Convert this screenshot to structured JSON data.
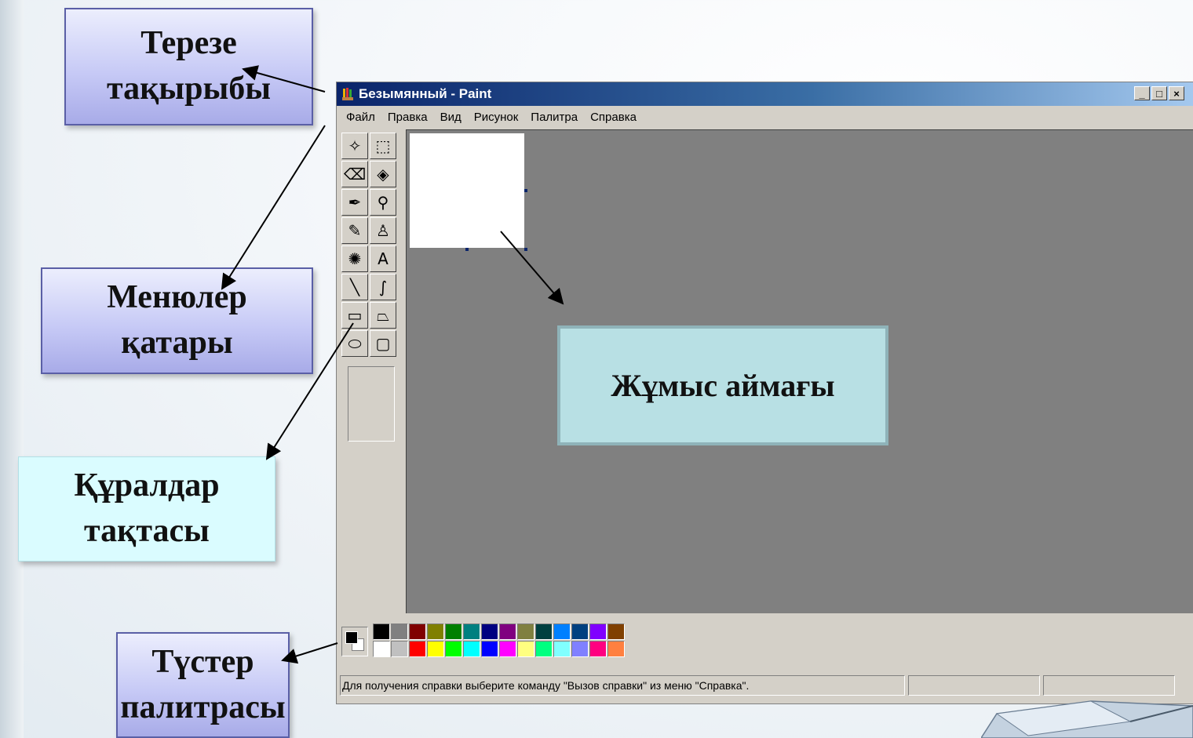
{
  "callouts": {
    "window_title": [
      "Терезе",
      "тақырыбы"
    ],
    "menu_bar": [
      "Менюлер",
      "қатары"
    ],
    "toolbox": [
      "Құралдар",
      "тақтасы"
    ],
    "palette": [
      "Түстер",
      "палитрасы"
    ],
    "work_area": "Жұмыс аймағы"
  },
  "paint": {
    "title": "Безымянный - Paint",
    "window_buttons": {
      "minimize": "_",
      "maximize": "□",
      "close": "×"
    },
    "menu": [
      "Файл",
      "Правка",
      "Вид",
      "Рисунок",
      "Палитра",
      "Справка"
    ],
    "tools": [
      {
        "name": "free-select",
        "icon": "✧"
      },
      {
        "name": "select",
        "icon": "⬚"
      },
      {
        "name": "eraser",
        "icon": "⌫"
      },
      {
        "name": "fill",
        "icon": "◈"
      },
      {
        "name": "color-picker",
        "icon": "✒"
      },
      {
        "name": "magnifier",
        "icon": "⚲"
      },
      {
        "name": "pencil",
        "icon": "✎"
      },
      {
        "name": "brush",
        "icon": "♙"
      },
      {
        "name": "airbrush",
        "icon": "✺"
      },
      {
        "name": "text",
        "icon": "A"
      },
      {
        "name": "line",
        "icon": "╲"
      },
      {
        "name": "curve",
        "icon": "∫"
      },
      {
        "name": "rectangle",
        "icon": "▭"
      },
      {
        "name": "polygon",
        "icon": "⏢"
      },
      {
        "name": "ellipse",
        "icon": "⬭"
      },
      {
        "name": "rounded-rectangle",
        "icon": "▢"
      }
    ],
    "palette_top": [
      "#000000",
      "#808080",
      "#800000",
      "#808000",
      "#008000",
      "#008080",
      "#000080",
      "#800080",
      "#808040",
      "#004040",
      "#0080ff",
      "#004080",
      "#8000ff",
      "#804000"
    ],
    "palette_bottom": [
      "#ffffff",
      "#c0c0c0",
      "#ff0000",
      "#ffff00",
      "#00ff00",
      "#00ffff",
      "#0000ff",
      "#ff00ff",
      "#ffff80",
      "#00ff80",
      "#80ffff",
      "#8080ff",
      "#ff0080",
      "#ff8040"
    ],
    "status_text": "Для получения справки выберите команду \"Вызов справки\" из меню \"Справка\"."
  }
}
